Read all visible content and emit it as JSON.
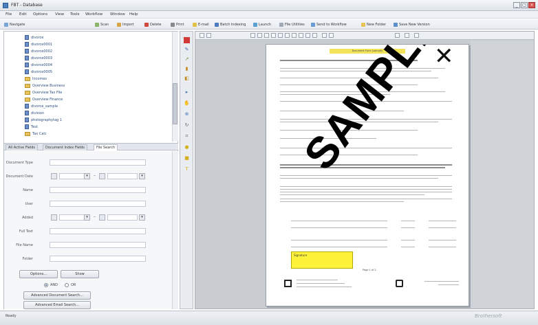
{
  "window": {
    "title": "FBT - Database"
  },
  "menu": [
    "File",
    "Edit",
    "Options",
    "View",
    "Tools",
    "Workflow",
    "Window",
    "Help"
  ],
  "toolbar": {
    "items": [
      "Navigate",
      "Scan",
      "Import",
      "Delete",
      "Print",
      "E-mail",
      "Batch Indexing",
      "Launch",
      "File Utilities",
      "Send to Workflow",
      "New Folder",
      "Save New Version"
    ]
  },
  "tree": {
    "items": [
      {
        "label": "divorce",
        "type": "doc"
      },
      {
        "label": "divorce0001",
        "type": "doc"
      },
      {
        "label": "divorce0002",
        "type": "doc"
      },
      {
        "label": "divorce0003",
        "type": "doc"
      },
      {
        "label": "divorce0004",
        "type": "doc"
      },
      {
        "label": "divorce0005",
        "type": "doc"
      },
      {
        "label": "Incomes",
        "type": "folder"
      },
      {
        "label": "Overview Business",
        "type": "folder"
      },
      {
        "label": "Overview Tax File",
        "type": "folder"
      },
      {
        "label": "Overview Finance",
        "type": "folder"
      },
      {
        "label": "divorce_sample",
        "type": "doc"
      },
      {
        "label": "division",
        "type": "doc"
      },
      {
        "label": "photographytag 1",
        "type": "doc"
      },
      {
        "label": "Test",
        "type": "doc"
      },
      {
        "label": "Tax Calc",
        "type": "folder"
      }
    ]
  },
  "tabs": {
    "items": [
      "All Active Fields",
      "Document Index Fields",
      "File Search"
    ],
    "active_index": 2
  },
  "search_form": {
    "document_type_label": "Document Type",
    "document_date_label": "Document Date",
    "name_label": "Name",
    "user_label": "User",
    "added_label": "Added",
    "full_text_label": "Full Text",
    "file_name_label": "File Name",
    "folder_label": "Folder",
    "options_button": "Options...",
    "show_button": "Show",
    "radio_and": "AND",
    "radio_or": "OR",
    "advanced_doc_button": "Advanced Document Search...",
    "advanced_email_button": "Advanced Email Search..."
  },
  "document": {
    "header_band": "Document Form (sample)",
    "stamp": "SAMPLE",
    "yellow_note": "Signature",
    "page_number": "Page 1 of 2"
  },
  "status": {
    "text": "Ready",
    "watermark": "Brothersoft"
  },
  "colors": {
    "highlight_yellow": "#fff23a",
    "header_band_yellow": "#f2e35a",
    "viewer_bg": "#c9ccd1",
    "close_red": "#d9534f"
  }
}
